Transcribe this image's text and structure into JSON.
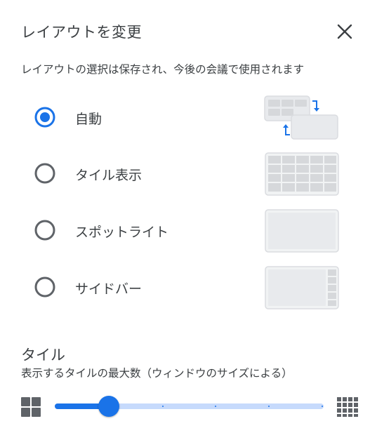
{
  "dialog": {
    "title": "レイアウトを変更",
    "close_icon": "close-icon",
    "subtitle": "レイアウトの選択は保存され、今後の会議で使用されます"
  },
  "layout_options": [
    {
      "label": "自動",
      "selected": true,
      "icon": "auto-layout-icon"
    },
    {
      "label": "タイル表示",
      "selected": false,
      "icon": "tiled-layout-icon"
    },
    {
      "label": "スポットライト",
      "selected": false,
      "icon": "spotlight-layout-icon"
    },
    {
      "label": "サイドバー",
      "selected": false,
      "icon": "sidebar-layout-icon"
    }
  ],
  "tiles": {
    "title": "タイル",
    "description": "表示するタイルの最大数（ウィンドウのサイズによる）",
    "min_icon": "four-tiles-icon",
    "max_icon": "many-tiles-icon",
    "slider_fraction": 0.2
  },
  "colors": {
    "accent": "#1a73e8",
    "track": "#c6dafc",
    "text": "#3c4043",
    "radio_off": "#5f6368",
    "thumb_bg": "#e8eaed",
    "thumb_border": "#dadce0"
  }
}
